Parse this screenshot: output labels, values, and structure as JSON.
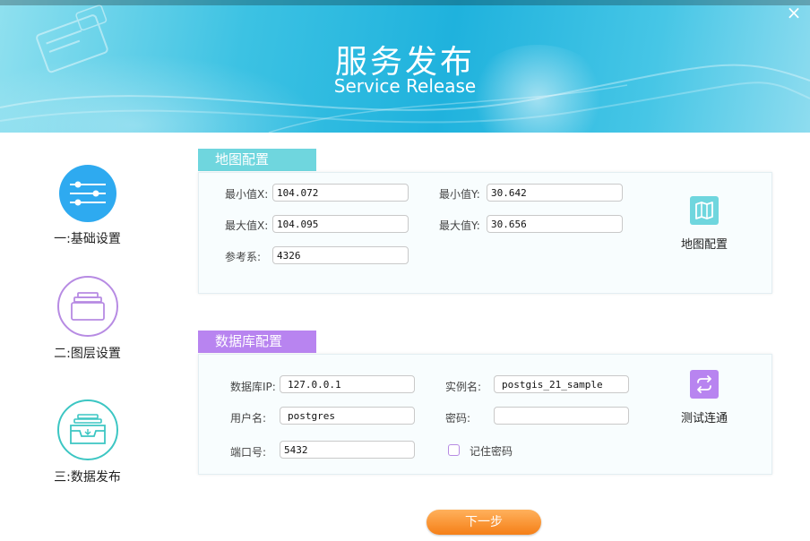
{
  "header": {
    "title_cn": "服务发布",
    "title_en": "Service Release",
    "close_symbol": "×"
  },
  "colors": {
    "accent_blue": "#2eaaf0",
    "accent_purple": "#b78be3",
    "accent_teal": "#3cc6c3",
    "tab_map": "#6fd6de",
    "tab_db": "#b884f0",
    "next_button": "#f7922a"
  },
  "steps": [
    {
      "label": "一:基础设置",
      "icon": "sliders-icon",
      "active": true
    },
    {
      "label": "二:图层设置",
      "icon": "layers-icon",
      "active": false
    },
    {
      "label": "三:数据发布",
      "icon": "inbox-icon",
      "active": false
    }
  ],
  "map_config": {
    "tab_label": "地图配置",
    "min_x_label": "最小值X:",
    "min_x": "104.072",
    "min_y_label": "最小值Y:",
    "min_y": "30.642",
    "max_x_label": "最大值X:",
    "max_x": "104.095",
    "max_y_label": "最大值Y:",
    "max_y": "30.656",
    "srs_label": "参考系:",
    "srs": "4326",
    "action_label": "地图配置",
    "action_icon": "map-icon"
  },
  "db_config": {
    "tab_label": "数据库配置",
    "ip_label": "数据库IP:",
    "ip": "127.0.0.1",
    "instance_label": "实例名:",
    "instance": "postgis_21_sample",
    "user_label": "用户名:",
    "user": "postgres",
    "password_label": "密码:",
    "password": "",
    "port_label": "端口号:",
    "port": "5432",
    "remember_label": "记住密码",
    "remember_checked": false,
    "action_label": "测试连通",
    "action_icon": "sync-icon"
  },
  "footer": {
    "next_label": "下一步"
  }
}
